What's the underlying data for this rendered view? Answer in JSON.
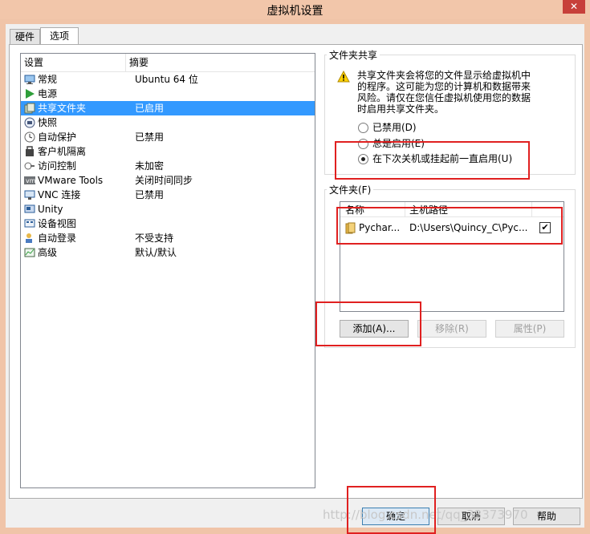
{
  "window": {
    "title": "虚拟机设置",
    "close": "✕"
  },
  "tabs": [
    {
      "label": "硬件"
    },
    {
      "label": "选项"
    }
  ],
  "settings": {
    "headers": {
      "setting": "设置",
      "summary": "摘要"
    },
    "items": [
      {
        "name": "常规",
        "summary": "Ubuntu 64 位",
        "icon": "monitor-icon"
      },
      {
        "name": "电源",
        "summary": "",
        "icon": "power-play-icon"
      },
      {
        "name": "共享文件夹",
        "summary": "已启用",
        "icon": "shared-folder-icon",
        "selected": true
      },
      {
        "name": "快照",
        "summary": "",
        "icon": "snapshot-icon"
      },
      {
        "name": "自动保护",
        "summary": "已禁用",
        "icon": "autoprotect-icon"
      },
      {
        "name": "客户机隔离",
        "summary": "",
        "icon": "isolation-icon"
      },
      {
        "name": "访问控制",
        "summary": "未加密",
        "icon": "access-control-icon"
      },
      {
        "name": "VMware Tools",
        "summary": "关闭时间同步",
        "icon": "vmware-tools-icon"
      },
      {
        "name": "VNC 连接",
        "summary": "已禁用",
        "icon": "vnc-icon"
      },
      {
        "name": "Unity",
        "summary": "",
        "icon": "unity-icon"
      },
      {
        "name": "设备视图",
        "summary": "",
        "icon": "device-view-icon"
      },
      {
        "name": "自动登录",
        "summary": "不受支持",
        "icon": "autologin-icon"
      },
      {
        "name": "高级",
        "summary": "默认/默认",
        "icon": "advanced-icon"
      }
    ]
  },
  "sharing": {
    "title": "文件夹共享",
    "warning_lines": [
      "共享文件夹会将您的文件显示给虚拟机中",
      "的程序。这可能为您的计算机和数据带来",
      "风险。请仅在您信任虚拟机使用您的数据",
      "时启用共享文件夹。"
    ],
    "options": [
      {
        "label": "已禁用(D)",
        "checked": false
      },
      {
        "label": "总是启用(E)",
        "checked": false
      },
      {
        "label": "在下次关机或挂起前一直启用(U)",
        "checked": true
      }
    ]
  },
  "folders": {
    "title": "文件夹(F)",
    "headers": {
      "name": "名称",
      "host_path": "主机路径"
    },
    "rows": [
      {
        "name": "Pychar...",
        "path": "D:\\Users\\Quincy_C\\Pyc...",
        "enabled": true
      }
    ],
    "buttons": {
      "add": "添加(A)...",
      "remove": "移除(R)",
      "properties": "属性(P)"
    }
  },
  "footer": {
    "ok": "确定",
    "cancel": "取消",
    "help": "帮助"
  },
  "watermark": "http://blog.csdn.net/qq_33373970"
}
